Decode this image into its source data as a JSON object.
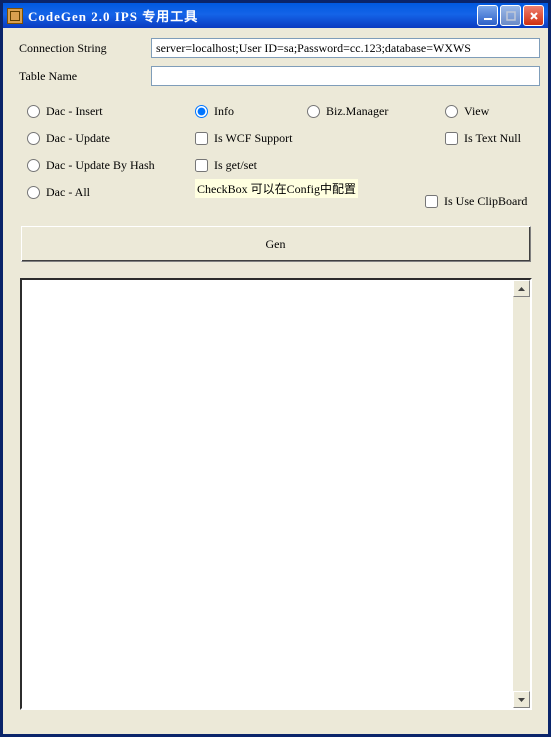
{
  "window": {
    "title": "CodeGen 2.0 IPS 专用工具"
  },
  "form": {
    "conn_label": "Connection String",
    "conn_value": "server=localhost;User ID=sa;Password=cc.123;database=WXWS",
    "table_label": "Table Name",
    "table_value": ""
  },
  "radios": {
    "dac_insert": "Dac - Insert",
    "dac_update": "Dac - Update",
    "dac_update_hash": "Dac - Update By Hash",
    "dac_all": "Dac - All",
    "info": "Info",
    "biz_manager": "Biz.Manager",
    "view": "View"
  },
  "checks": {
    "wcf": "Is WCF Support",
    "getset": "Is get/set",
    "text_null": "Is Text Null",
    "clipboard": "Is Use ClipBoard"
  },
  "hint": "CheckBox 可以在Config中配置",
  "gen_button": "Gen",
  "output": ""
}
